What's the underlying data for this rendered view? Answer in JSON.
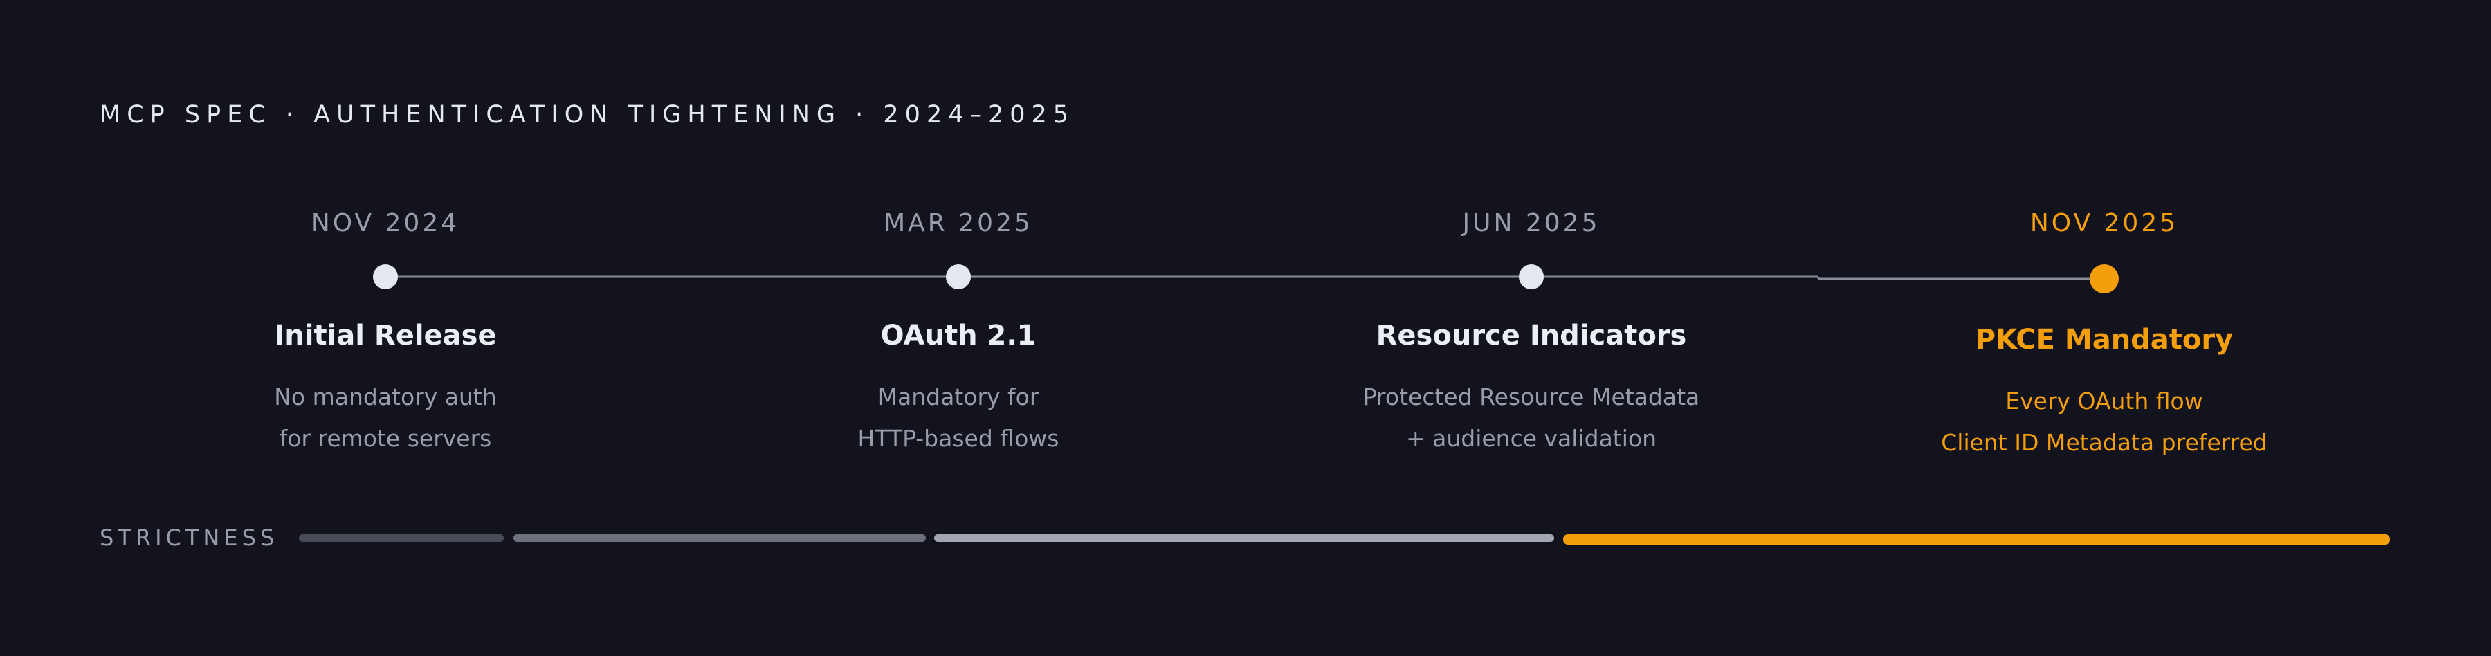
{
  "title": "MCP SPEC · AUTHENTICATION TIGHTENING · 2024–2025",
  "milestones": [
    {
      "date": "NOV 2024",
      "title": "Initial Release",
      "desc": [
        "No mandatory auth",
        "for remote servers"
      ]
    },
    {
      "date": "MAR 2025",
      "title": "OAuth 2.1",
      "desc": [
        "Mandatory for",
        "HTTP-based flows"
      ]
    },
    {
      "date": "JUN 2025",
      "title": "Resource Indicators",
      "desc": [
        "Protected Resource Metadata",
        "+ audience validation"
      ]
    },
    {
      "date": "NOV 2025",
      "title": "PKCE Mandatory",
      "desc": [
        "Every OAuth flow",
        "Client ID Metadata preferred"
      ]
    }
  ],
  "strictness": {
    "label": "STRICTNESS",
    "levels": [
      1,
      2,
      3,
      4
    ]
  },
  "colors": {
    "background": "#13131e",
    "accent": "#f59e0b",
    "text": "#eceef5",
    "muted": "#9a9cab",
    "node": "#e6e8f0",
    "line": "#8a8c99",
    "strict_levels": [
      "#4a4b58",
      "#6e707d",
      "#a3a5b1",
      "#f59e0b"
    ]
  }
}
